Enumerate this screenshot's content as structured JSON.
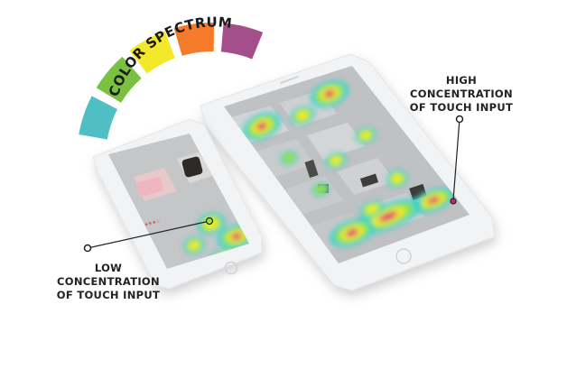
{
  "spectrum": {
    "title": "COLOR SPECTRUM",
    "colors": [
      "#4fbfc4",
      "#7ac142",
      "#f3e82a",
      "#f47b2a",
      "#a44f8b"
    ]
  },
  "annotations": {
    "high": [
      "HIGH",
      "CONCENTRATION",
      "OF TOUCH INPUT"
    ],
    "low": [
      "LOW",
      "CONCENTRATION",
      "OF TOUCH INPUT"
    ]
  },
  "phone_small": {
    "listings": [
      {
        "rating": "★★★★☆"
      },
      {
        "rating": "★★★★☆"
      }
    ]
  },
  "heat_colors": {
    "low": "#2bd3d0",
    "mid": "#9be33a",
    "high": "#f7ef1f",
    "peak": "#e0197c"
  }
}
